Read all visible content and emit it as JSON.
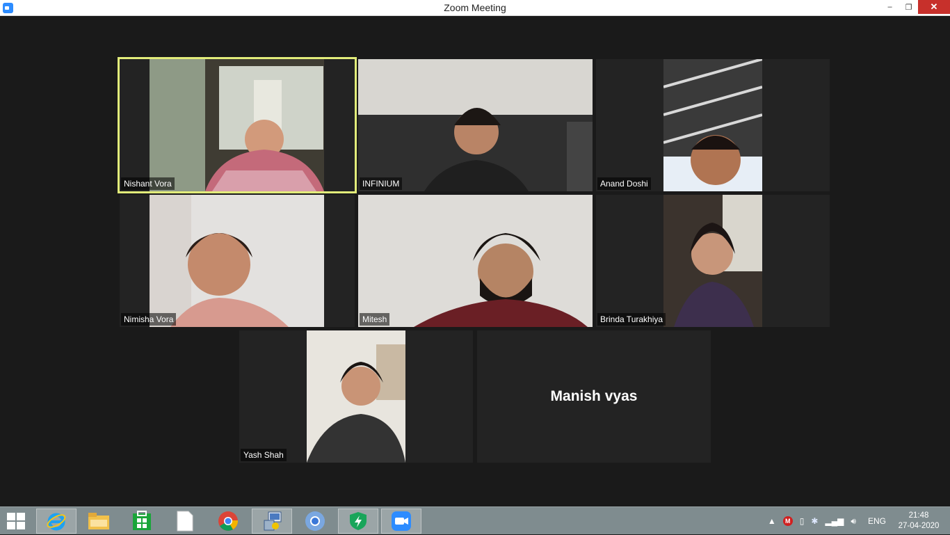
{
  "window": {
    "title": "Zoom Meeting",
    "controls": {
      "minimize": "–",
      "restore": "❐",
      "close": "✕"
    }
  },
  "participants": [
    {
      "name": "Nishant Vora",
      "active_speaker": true
    },
    {
      "name": "INFINIUM"
    },
    {
      "name": "Anand Doshi"
    },
    {
      "name": "Nimisha Vora"
    },
    {
      "name": "Mitesh"
    },
    {
      "name": "Brinda Turakhiya"
    },
    {
      "name": "Yash Shah"
    },
    {
      "name": "Manish vyas",
      "video_off": true
    }
  ],
  "taskbar": {
    "apps": [
      "internet-explorer-icon",
      "file-explorer-icon",
      "store-icon",
      "document-icon",
      "chrome-icon",
      "network-icon",
      "chromium-icon",
      "security-icon",
      "zoom-icon"
    ],
    "tray": {
      "language": "ENG",
      "time": "21:48",
      "date": "27-04-2020"
    }
  }
}
